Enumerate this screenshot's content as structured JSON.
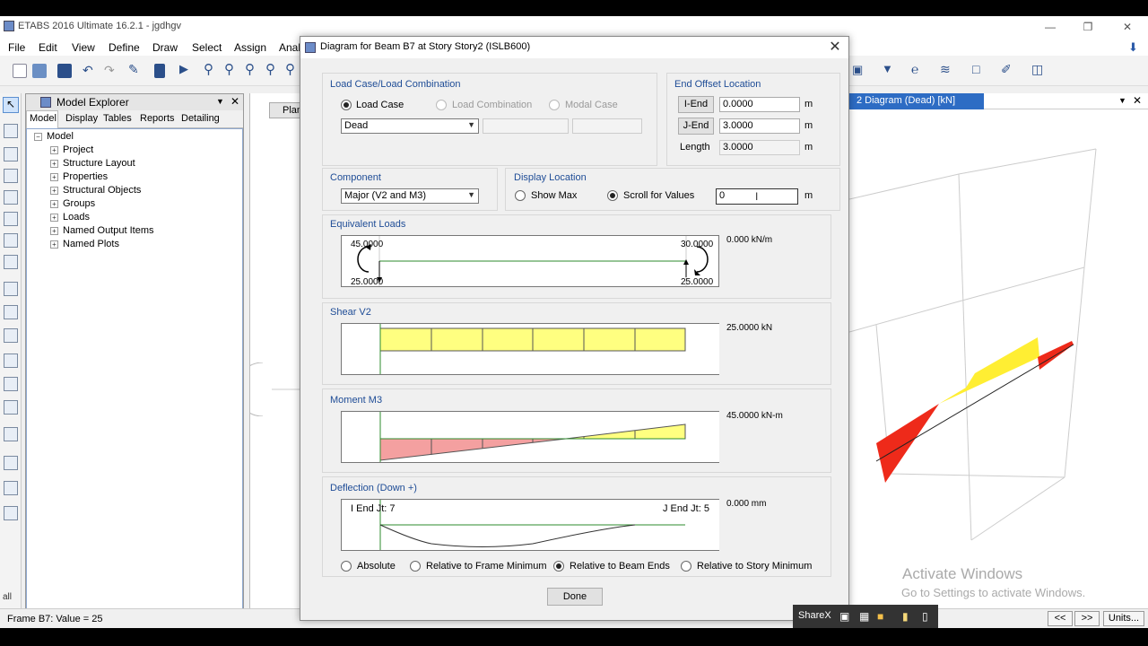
{
  "app": {
    "title": "ETABS 2016 Ultimate 16.2.1 - jgdhgv",
    "menus": [
      "File",
      "Edit",
      "View",
      "Define",
      "Draw",
      "Select",
      "Assign",
      "Anal"
    ]
  },
  "explorer": {
    "title": "Model Explorer",
    "tabs": [
      "Model",
      "Display",
      "Tables",
      "Reports",
      "Detailing"
    ],
    "root": "Model",
    "nodes": [
      "Project",
      "Structure Layout",
      "Properties",
      "Structural Objects",
      "Groups",
      "Loads",
      "Named Output Items",
      "Named Plots"
    ]
  },
  "plan_tab": "Plan",
  "right_tab": "2 Diagram   (Dead)  [kN]",
  "status": {
    "text": "Frame B7:  Value = 25",
    "prev": "<<",
    "next": ">>",
    "units": "Units..."
  },
  "sharex": "ShareX",
  "watermark": {
    "line1": "Activate Windows",
    "line2": "Go to Settings to activate Windows."
  },
  "dialog": {
    "title": "Diagram for Beam B7 at Story Story2 (ISLB600)",
    "load_case_group": {
      "label": "Load Case/Load Combination",
      "opt_load_case": "Load Case",
      "opt_load_combo": "Load Combination",
      "opt_modal": "Modal Case",
      "selected": "Dead"
    },
    "end_offset": {
      "label": "End Offset Location",
      "i_end_label": "I-End",
      "i_end_value": "0.0000",
      "j_end_label": "J-End",
      "j_end_value": "3.0000",
      "length_label": "Length",
      "length_value": "3.0000",
      "unit": "m"
    },
    "component": {
      "label": "Component",
      "selected": "Major (V2 and M3)"
    },
    "display_location": {
      "label": "Display Location",
      "show_max": "Show Max",
      "scroll": "Scroll for Values",
      "value": "0",
      "unit": "m"
    },
    "equivalent_loads": {
      "label": "Equivalent Loads",
      "left_top": "45.0000",
      "left_bottom": "25.0000",
      "right_top": "30.0000",
      "right_bottom": "25.0000",
      "value": "0.000 kN/m"
    },
    "shear": {
      "label": "Shear V2",
      "value": "25.0000 kN"
    },
    "moment": {
      "label": "Moment M3",
      "value": "45.0000 kN-m"
    },
    "deflection": {
      "label": "Deflection (Down +)",
      "i_end": "I End Jt: 7",
      "j_end": "J End Jt: 5",
      "value": "0.000 mm",
      "opt_absolute": "Absolute",
      "opt_frame_min": "Relative to Frame Minimum",
      "opt_beam_ends": "Relative to Beam Ends",
      "opt_story_min": "Relative to Story Minimum"
    },
    "done": "Done"
  },
  "colors": {
    "shear_fill": "#ffff80",
    "moment_neg": "#f4a0a0",
    "moment_pos": "#ffff80",
    "baseline": "#2e8b2e",
    "label_blue": "#1e4c96"
  }
}
